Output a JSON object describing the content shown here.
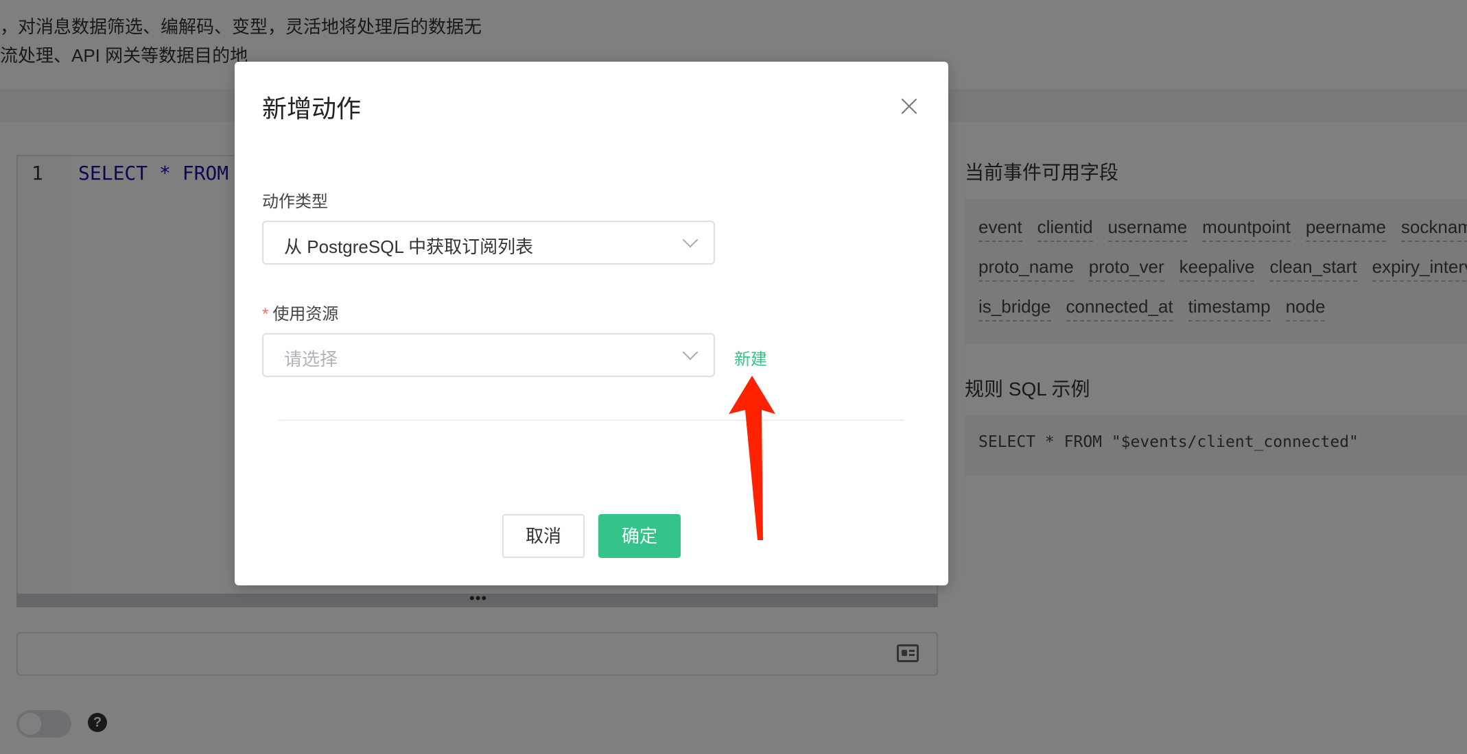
{
  "background": {
    "description_lines": [
      "，对消息数据筛选、编解码、变型，灵活地将处理后的数据无",
      "流处理、API 网关等数据目的地"
    ],
    "editor": {
      "line_number": "1",
      "code": "SELECT * FROM",
      "resize_handle": "•••"
    },
    "side_panel": {
      "fields_title": "当前事件可用字段",
      "fields_rows": [
        [
          "event",
          "clientid",
          "username",
          "mountpoint",
          "peername",
          "sockname"
        ],
        [
          "proto_name",
          "proto_ver",
          "keepalive",
          "clean_start",
          "expiry_interval"
        ],
        [
          "is_bridge",
          "connected_at",
          "timestamp",
          "node"
        ]
      ],
      "sql_title": "规则 SQL 示例",
      "sql_example": "SELECT * FROM \"$events/client_connected\""
    },
    "help_icon": "?"
  },
  "dialog": {
    "title": "新增动作",
    "action_type": {
      "label": "动作类型",
      "value": "从 PostgreSQL 中获取订阅列表"
    },
    "resource": {
      "required_mark": "*",
      "label": "使用资源",
      "placeholder": "请选择",
      "new_link": "新建"
    },
    "buttons": {
      "cancel": "取消",
      "confirm": "确定"
    }
  },
  "colors": {
    "primary": "#34c388",
    "arrow": "#ff2200",
    "required": "#f56c6c"
  }
}
